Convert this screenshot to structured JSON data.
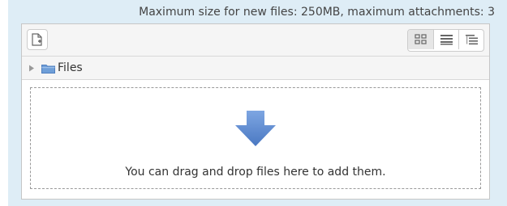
{
  "limits_text": "Maximum size for new files: 250MB, maximum attachments: 3",
  "toolbar": {
    "add_file_icon": "add-file-icon",
    "view_modes": [
      {
        "name": "icons",
        "icon": "grid-icon",
        "active": true
      },
      {
        "name": "details",
        "icon": "list-icon",
        "active": false
      },
      {
        "name": "tree",
        "icon": "tree-icon",
        "active": false
      }
    ]
  },
  "path": {
    "folder_label": "Files",
    "folder_icon": "folder-icon",
    "toggle_icon": "triangle-right-icon"
  },
  "dropzone": {
    "arrow_icon": "arrow-down-icon",
    "message": "You can drag and drop files here to add them."
  },
  "colors": {
    "panel_background": "#deedf6",
    "arrow": "#5b87cc",
    "folder": "#6f9fd8"
  }
}
